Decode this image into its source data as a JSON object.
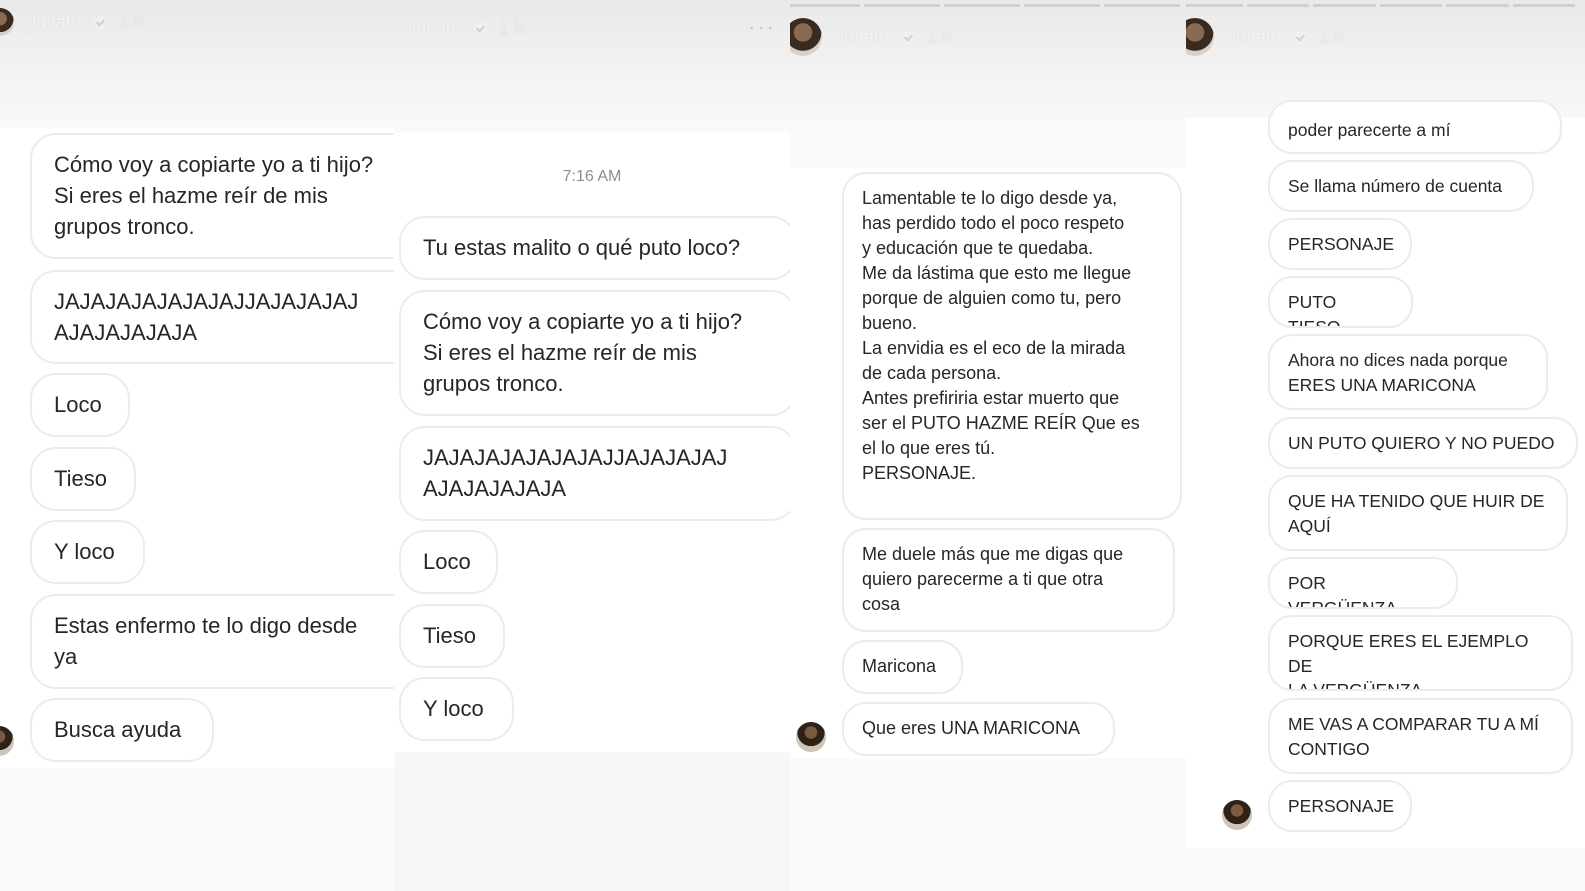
{
  "panels": [
    {
      "username": "_lucati_",
      "time": "1 h",
      "messages": [
        "Cómo voy a copiarte yo a ti hijo?\nSi eres el hazme reír de mis\ngrupos tronco.",
        "JAJAJAJAJAJAJAJJAJAJAJAJ\nAJAJAJAJAJA",
        "Loco",
        "Tieso",
        "Y loco",
        "Estas enfermo te lo digo desde\nya",
        "Busca ayuda"
      ]
    },
    {
      "username": "_lucati_",
      "time": "1 h",
      "more": "···",
      "timestamp": "7:16 AM",
      "messages": [
        "Tu estas malito o qué puto loco?",
        "Cómo voy a copiarte yo a ti hijo?\nSi eres el hazme reír de mis\ngrupos tronco.",
        "JAJAJAJAJAJAJAJJAJAJAJAJ\nAJAJAJAJAJA",
        "Loco",
        "Tieso",
        "Y loco"
      ]
    },
    {
      "username": "_lucati_",
      "time": "1 h",
      "messages": [
        "Lamentable te lo digo desde ya,\nhas perdido todo el poco respeto\ny educación que te quedaba.\nMe da lástima que esto me llegue\nporque de alguien como tu, pero\nbueno.\nLa envidia es el eco de la mirada\nde cada persona.\nAntes prefiriria estar muerto que\nser el PUTO HAZME REÍR Que es\nel lo que eres tú.\n PERSONAJE.",
        "Me duele más que me digas que\nquiero parecerme a ti que otra\ncosa",
        "Maricona",
        "Que eres UNA MARICONA"
      ]
    },
    {
      "username": "_lucati_",
      "time": "1 h",
      "messages": [
        "poder parecerte a mí",
        "Se llama número de cuenta",
        "PERSONAJE",
        "PUTO TIESO",
        "Ahora no dices nada porque\nERES UNA MARICONA",
        "UN PUTO QUIERO Y NO PUEDO",
        "QUE HA TENIDO QUE HUIR DE\nAQUÍ",
        "POR VERGÜENZA",
        "PORQUE ERES EL EJEMPLO DE\nLA VERGÜENZA",
        "ME VAS A COMPARAR TU A MÍ\nCONTIGO",
        "PERSONAJE"
      ]
    }
  ]
}
